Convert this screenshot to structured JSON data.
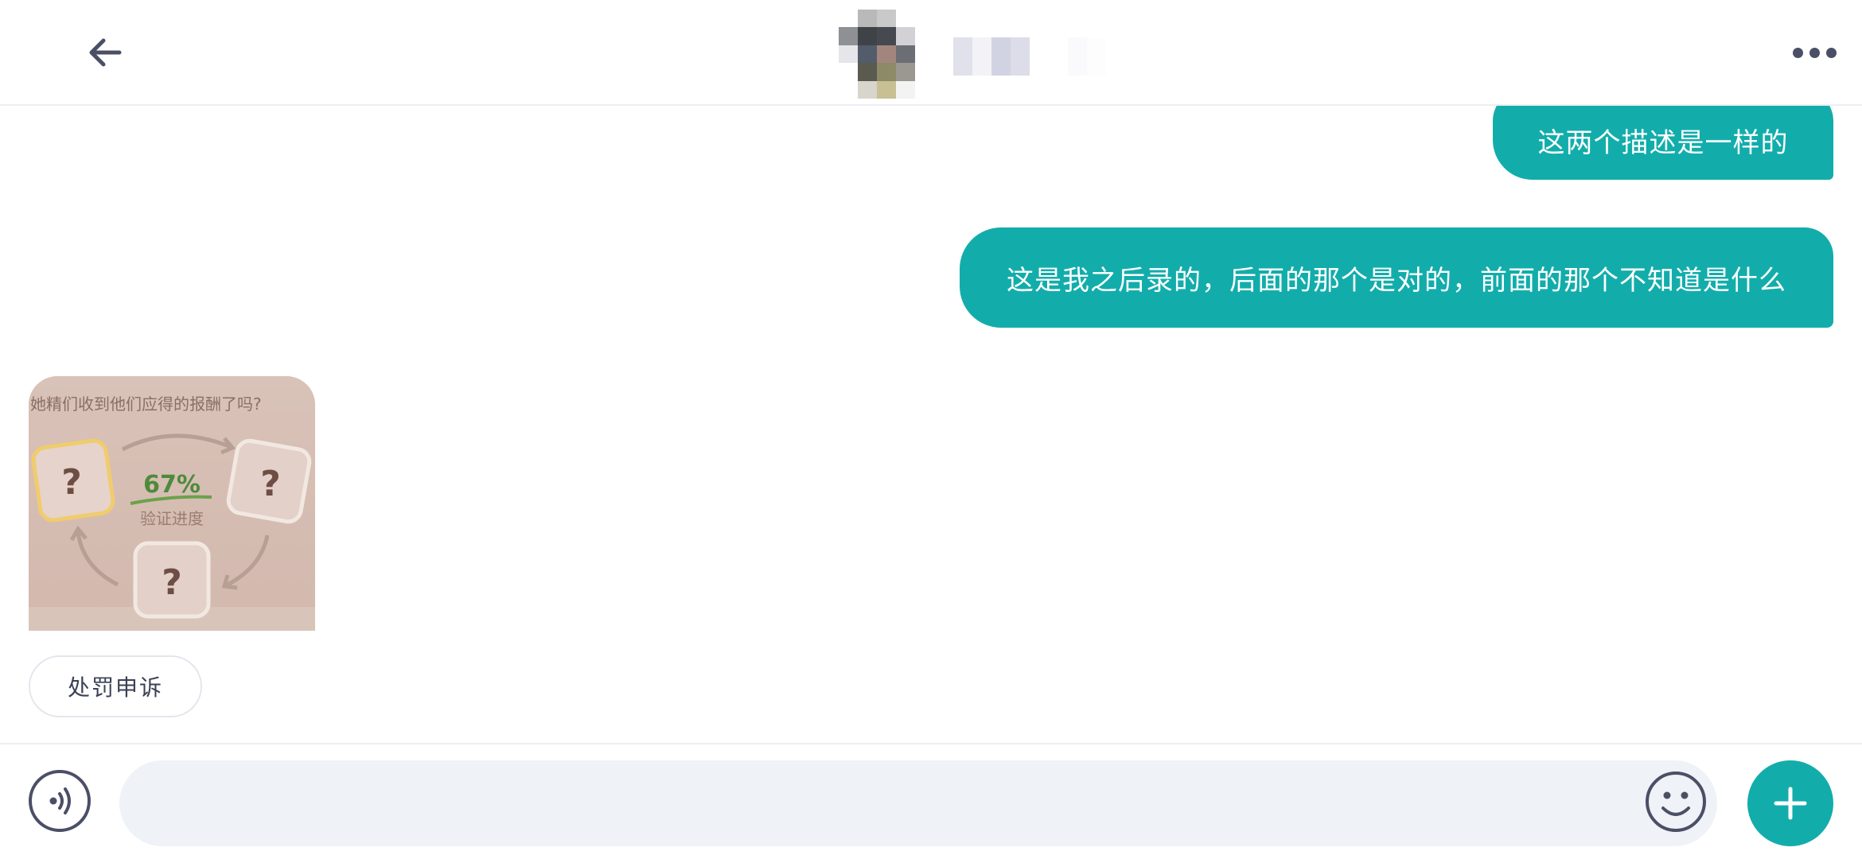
{
  "header": {
    "back_icon": "arrow-left-icon",
    "contact_avatar": "blurred-avatar",
    "more_icon": "more-horizontal-icon"
  },
  "messages": [
    {
      "direction": "outgoing",
      "text": "这两个描述是一样的"
    },
    {
      "direction": "outgoing",
      "text": "这是我之后录的，后面的那个是对的，前面的那个不知道是什么"
    },
    {
      "direction": "incoming",
      "type": "image",
      "image_text": {
        "question": "她精们收到他们应得的报酬了吗?",
        "progress": "67%",
        "progress_label": "验证进度",
        "card_mark": "?"
      }
    }
  ],
  "actions": {
    "appeal_label": "处罚申诉"
  },
  "input_bar": {
    "voice_icon": "voice-icon",
    "placeholder": "",
    "emoji_icon": "smiley-icon",
    "plus_icon": "plus-icon"
  },
  "colors": {
    "accent": "#12adab",
    "icon": "#4b4f66",
    "input_bg": "#eff2f6"
  }
}
